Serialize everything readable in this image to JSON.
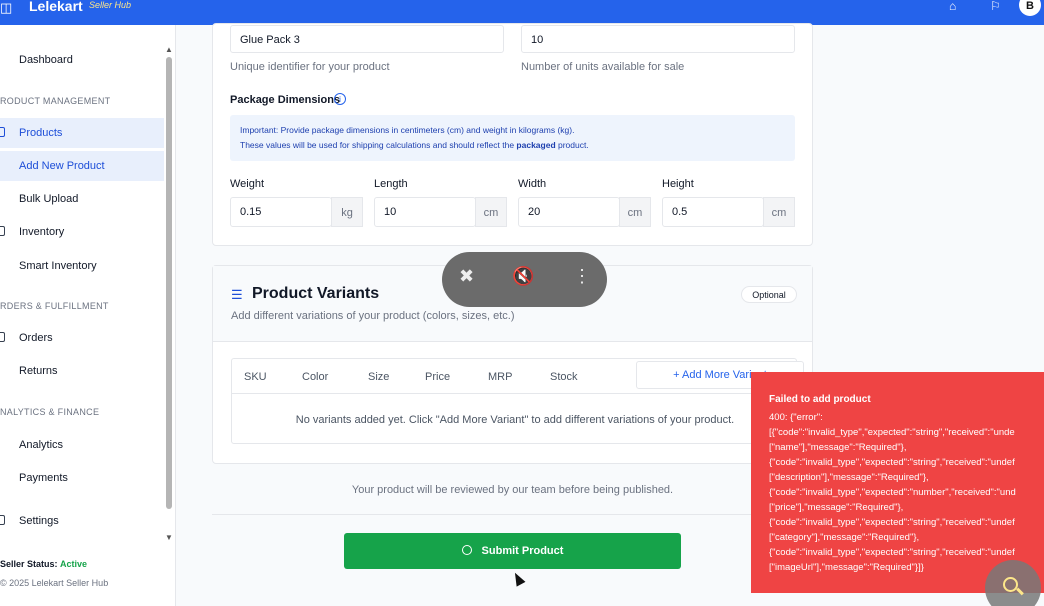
{
  "topbar": {
    "brand": "Lelekart",
    "brand_sub": "Seller Hub",
    "avatar": "B",
    "menu_icon": "sidebar-toggle-icon",
    "store_icon": "store-icon",
    "bell_icon": "bell-icon"
  },
  "sidebar": {
    "dashboard": "Dashboard",
    "sec_product": "RODUCT MANAGEMENT",
    "products": "Products",
    "add_new_product": "Add New Product",
    "bulk_upload": "Bulk Upload",
    "inventory": "Inventory",
    "smart_inventory": "Smart Inventory",
    "sec_orders": "RDERS & FULFILLMENT",
    "orders": "Orders",
    "returns": "Returns",
    "sec_analytics": "NALYTICS & FINANCE",
    "analytics": "Analytics",
    "payments": "Payments",
    "settings": "Settings",
    "status_label": "Seller Status:",
    "status_value": "Active",
    "copyright": "© 2025 Lelekart Seller Hub"
  },
  "form": {
    "sku_value": "Glue Pack 3",
    "sku_help": "Unique identifier for your product",
    "stock_value": "10",
    "stock_help": "Number of units available for sale",
    "package_title": "Package Dimensions",
    "info_line1": "Important: Provide package dimensions in centimeters (cm) and weight in kilograms (kg).",
    "info_line2_a": "These values will be used for shipping calculations and should reflect the ",
    "info_line2_bold": "packaged",
    "info_line2_b": " product.",
    "weight_label": "Weight",
    "weight_value": "0.15",
    "weight_unit": "kg",
    "length_label": "Length",
    "length_value": "10",
    "length_unit": "cm",
    "width_label": "Width",
    "width_value": "20",
    "width_unit": "cm",
    "height_label": "Height",
    "height_value": "0.5",
    "height_unit": "cm"
  },
  "variants": {
    "title": "Product Variants",
    "subtitle": "Add different variations of your product (colors, sizes, etc.)",
    "optional": "Optional",
    "columns": [
      "SKU",
      "Color",
      "Size",
      "Price",
      "MRP",
      "Stock"
    ],
    "add_button": "+ Add More Variant",
    "empty_text": "No variants added yet. Click \"Add More Variant\" to add different variations of your product."
  },
  "review_text": "Your product will be reviewed by our team before being published.",
  "submit_label": "Submit Product",
  "toast": {
    "title": "Failed to add product",
    "body": "400: {\"error\":\n[{\"code\":\"invalid_type\",\"expected\":\"string\",\"received\":\"unde\n[\"name\"],\"message\":\"Required\"},\n{\"code\":\"invalid_type\",\"expected\":\"string\",\"received\":\"undef\n[\"description\"],\"message\":\"Required\"},\n{\"code\":\"invalid_type\",\"expected\":\"number\",\"received\":\"und\n[\"price\"],\"message\":\"Required\"},\n{\"code\":\"invalid_type\",\"expected\":\"string\",\"received\":\"undef\n[\"category\"],\"message\":\"Required\"},\n{\"code\":\"invalid_type\",\"expected\":\"string\",\"received\":\"undef\n[\"imageUrl\"],\"message\":\"Required\"}]}"
  },
  "colors": {
    "primary": "#2563eb",
    "success": "#16a34a",
    "danger": "#ef4444"
  }
}
